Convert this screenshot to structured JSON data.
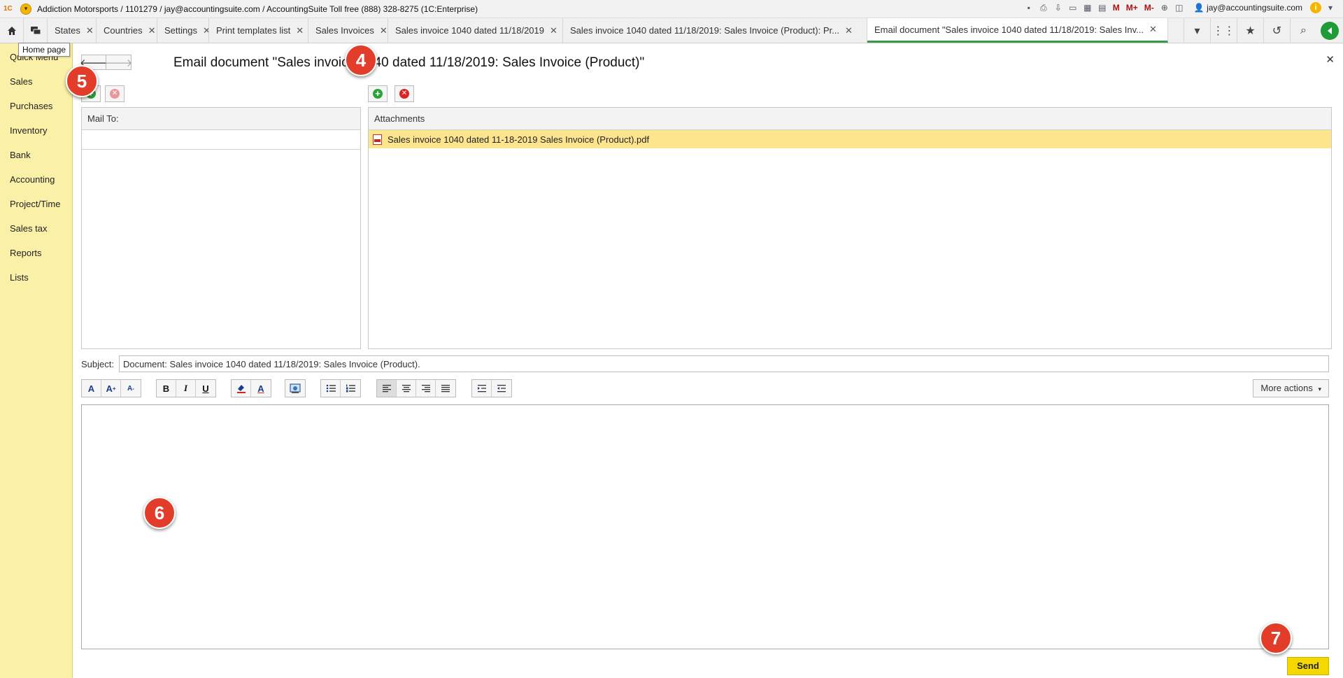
{
  "window": {
    "title": "Addiction Motorsports / 1101279 / jay@accountingsuite.com / AccountingSuite Toll free (888) 328-8275  (1C:Enterprise)",
    "logo_text": "1С",
    "user": "jay@accountingsuite.com",
    "toolbar_labels": {
      "m": "M",
      "m_plus": "M+",
      "m_minus": "M-"
    }
  },
  "tabs": [
    {
      "label": "States"
    },
    {
      "label": "Countries"
    },
    {
      "label": "Settings"
    },
    {
      "label": "Print templates list"
    },
    {
      "label": "Sales Invoices"
    },
    {
      "label": "Sales invoice 1040 dated 11/18/2019"
    },
    {
      "label": "Sales invoice 1040 dated 11/18/2019: Sales Invoice (Product): Pr..."
    },
    {
      "label": "Email document \"Sales invoice 1040 dated 11/18/2019: Sales Inv...",
      "active": true
    }
  ],
  "tooltip": "Home page",
  "sidebar": {
    "items": [
      {
        "label": "Quick Menu"
      },
      {
        "label": "Sales"
      },
      {
        "label": "Purchases"
      },
      {
        "label": "Inventory"
      },
      {
        "label": "Bank"
      },
      {
        "label": "Accounting"
      },
      {
        "label": "Project/Time"
      },
      {
        "label": "Sales tax"
      },
      {
        "label": "Reports"
      },
      {
        "label": "Lists"
      }
    ]
  },
  "form": {
    "title": "Email document \"Sales invoice 1040 dated 11/18/2019: Sales Invoice (Product)\"",
    "mail_to_header": "Mail To:",
    "attachments_header": "Attachments",
    "attachments": [
      {
        "name": "Sales invoice 1040 dated 11-18-2019  Sales Invoice (Product).pdf"
      }
    ],
    "subject_label": "Subject:",
    "subject_value": "Document: Sales invoice 1040 dated 11/18/2019: Sales Invoice (Product).",
    "more_actions": "More actions",
    "send_label": "Send"
  },
  "toolbar_glyphs": {
    "font": "A",
    "font_larger": "A",
    "font_smaller": "A",
    "bold": "B",
    "italic": "I",
    "underline": "U",
    "text_color": "A"
  },
  "callouts": [
    "4",
    "5",
    "6",
    "7"
  ],
  "colors": {
    "sidebar_bg": "#fbf0a8",
    "active_tab_accent": "#3a9a4a",
    "selected_row": "#fde58e",
    "send_button": "#f5d800",
    "callout": "#e23d2a"
  }
}
